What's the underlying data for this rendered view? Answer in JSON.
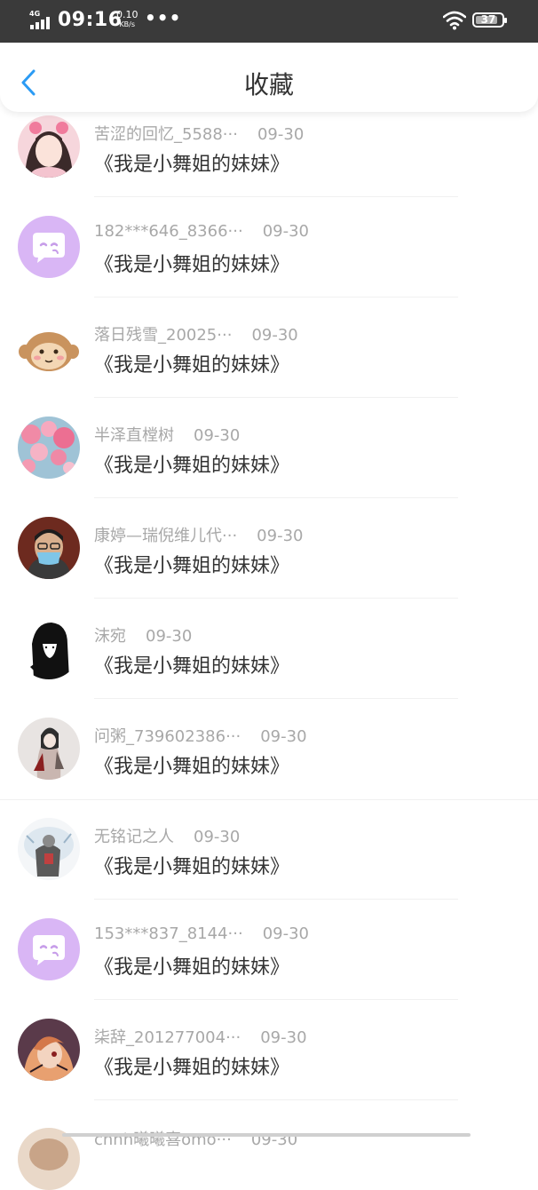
{
  "status_bar": {
    "network": "4G",
    "time": "09:16",
    "speed_value": "0.10",
    "speed_unit": "KB/s",
    "more": "•••",
    "battery": "37"
  },
  "header": {
    "title": "收藏",
    "back_icon": "chevron-left-icon"
  },
  "items": [
    {
      "user": "苦涩的回忆_5588···",
      "date": "09-30",
      "work": "《我是小舞姐的妹妹》",
      "avatar": "anime-girl-avatar"
    },
    {
      "user": "182***646_8366···",
      "date": "09-30",
      "work": "《我是小舞姐的妹妹》",
      "avatar": "default-chat-avatar"
    },
    {
      "user": "落日残雪_20025···",
      "date": "09-30",
      "work": "《我是小舞姐的妹妹》",
      "avatar": "monkey-avatar"
    },
    {
      "user": "半泽直樘树",
      "date": "09-30",
      "work": "《我是小舞姐的妹妹》",
      "avatar": "flowers-avatar"
    },
    {
      "user": "康婷—瑞倪维儿代···",
      "date": "09-30",
      "work": "《我是小舞姐的妹妹》",
      "avatar": "photo-avatar"
    },
    {
      "user": "沫宛",
      "date": "09-30",
      "work": "《我是小舞姐的妹妹》",
      "avatar": "silhouette-avatar"
    },
    {
      "user": "问粥_739602386···",
      "date": "09-30",
      "work": "《我是小舞姐的妹妹》",
      "avatar": "character-avatar"
    },
    {
      "user": "无铭记之人",
      "date": "09-30",
      "work": "《我是小舞姐的妹妹》",
      "avatar": "character-avatar-2"
    },
    {
      "user": "153***837_8144···",
      "date": "09-30",
      "work": "《我是小舞姐的妹妹》",
      "avatar": "default-chat-avatar"
    },
    {
      "user": "柒辞_201277004···",
      "date": "09-30",
      "work": "《我是小舞姐的妹妹》",
      "avatar": "anime-avatar"
    },
    {
      "user": "cnnh曦曦喜omo···",
      "date": "09-30",
      "work": "",
      "avatar": "partial-avatar"
    }
  ],
  "colors": {
    "status_bar_bg": "#3a3a3a",
    "accent_blue": "#2b9bf4",
    "default_avatar_bg": "#d9b6f5"
  }
}
